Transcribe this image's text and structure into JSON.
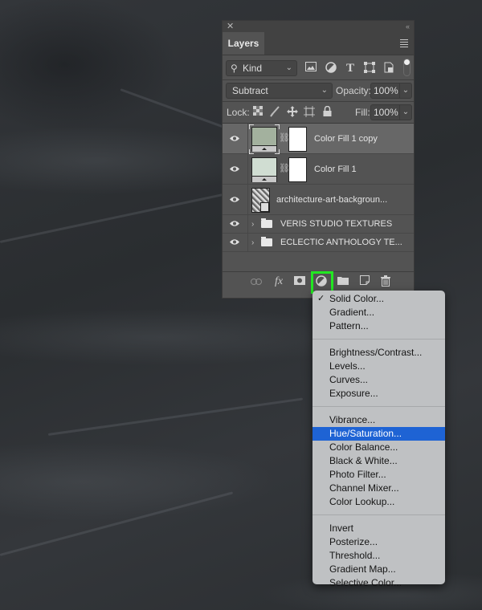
{
  "panel": {
    "tab_label": "Layers",
    "filter": {
      "kind_label": "Kind"
    },
    "blend_mode": "Subtract",
    "opacity_label": "Opacity:",
    "opacity_value": "100%",
    "lock_label": "Lock:",
    "fill_label": "Fill:",
    "fill_value": "100%",
    "layers": [
      {
        "name": "Color Fill 1 copy",
        "type": "fill",
        "swatch": "#a3b19e",
        "selected": true,
        "visible": true
      },
      {
        "name": "Color Fill 1",
        "type": "fill",
        "swatch": "#d0ddd2",
        "selected": false,
        "visible": true
      },
      {
        "name": "architecture-art-backgroun...",
        "type": "smart-object",
        "selected": false,
        "visible": true
      },
      {
        "name": "VERIS STUDIO TEXTURES",
        "type": "group",
        "selected": false,
        "visible": true
      },
      {
        "name": "ECLECTIC ANTHOLOGY TE...",
        "type": "group",
        "selected": false,
        "visible": true
      }
    ]
  },
  "menu": {
    "groups": [
      [
        {
          "label": "Solid Color...",
          "checked": true
        },
        {
          "label": "Gradient..."
        },
        {
          "label": "Pattern..."
        }
      ],
      [
        {
          "label": "Brightness/Contrast..."
        },
        {
          "label": "Levels..."
        },
        {
          "label": "Curves..."
        },
        {
          "label": "Exposure..."
        }
      ],
      [
        {
          "label": "Vibrance..."
        },
        {
          "label": "Hue/Saturation...",
          "highlighted": true
        },
        {
          "label": "Color Balance..."
        },
        {
          "label": "Black & White..."
        },
        {
          "label": "Photo Filter..."
        },
        {
          "label": "Channel Mixer..."
        },
        {
          "label": "Color Lookup..."
        }
      ],
      [
        {
          "label": "Invert"
        },
        {
          "label": "Posterize..."
        },
        {
          "label": "Threshold..."
        },
        {
          "label": "Gradient Map..."
        },
        {
          "label": "Selective Color..."
        }
      ]
    ],
    "check_glyph": "✓"
  },
  "colors": {
    "highlight_box": "#22e822",
    "menu_highlight": "#1e63d4"
  }
}
